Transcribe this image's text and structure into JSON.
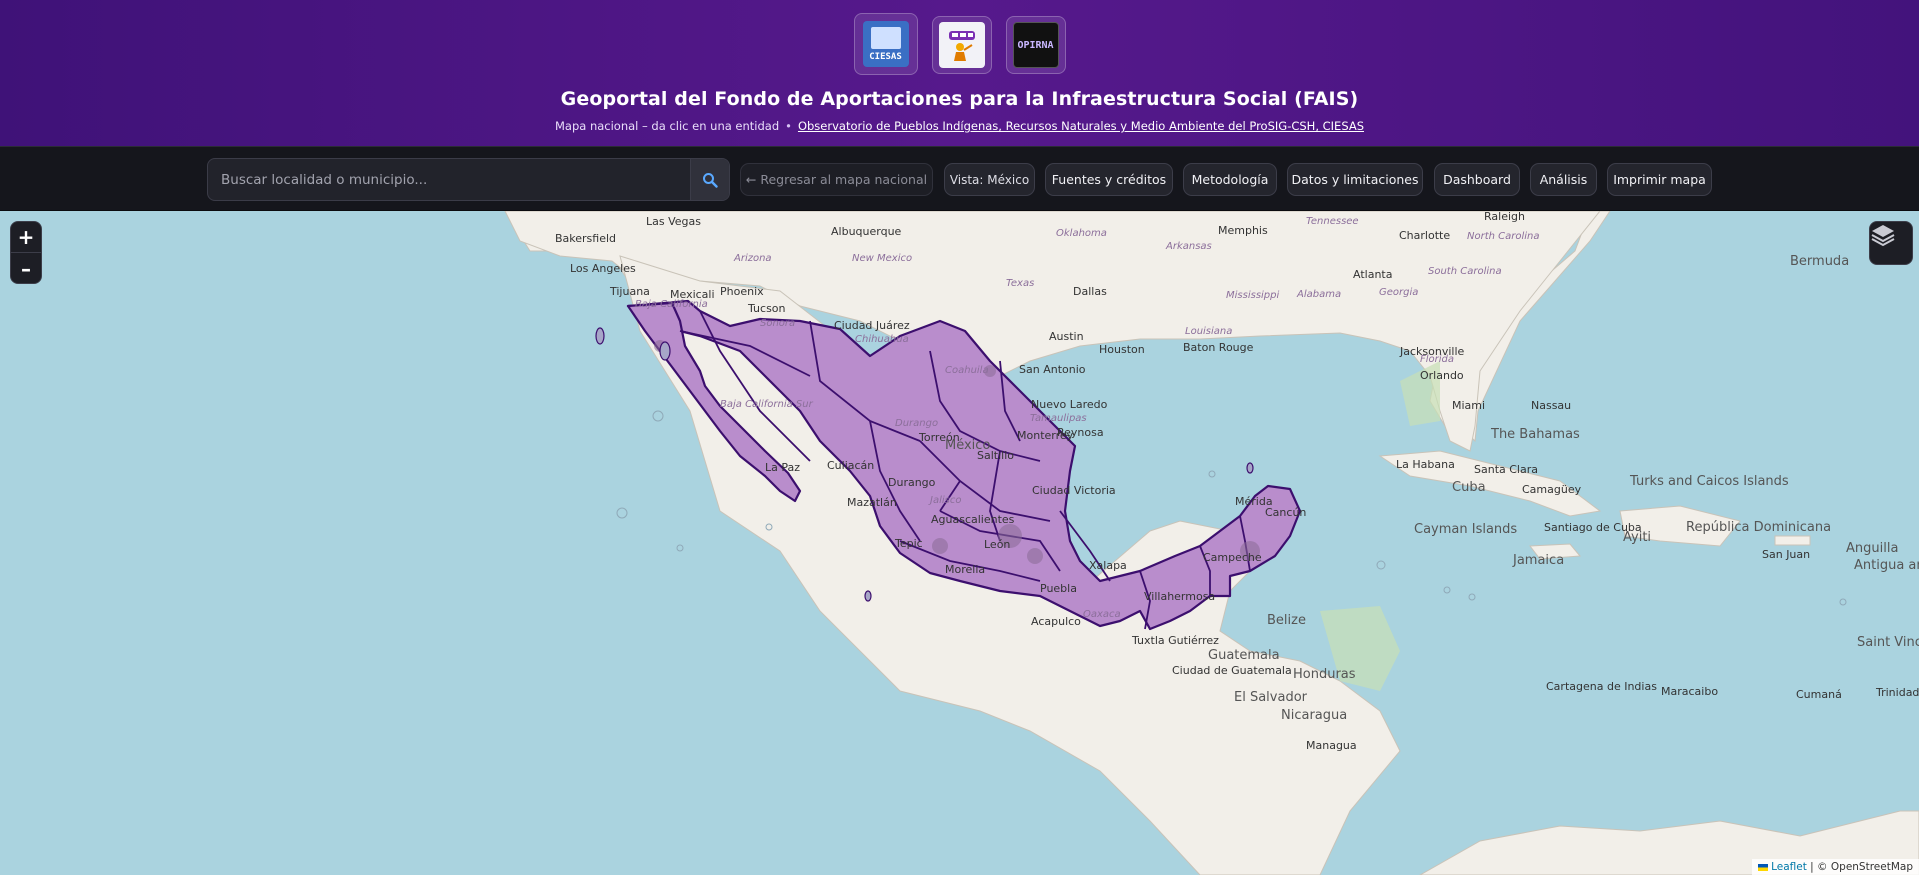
{
  "header": {
    "logos": [
      {
        "name": "ciesas-logo",
        "text": "CIESAS"
      },
      {
        "name": "fais-logo",
        "text": ""
      },
      {
        "name": "opirna-logo",
        "text": "OPIRNA"
      }
    ],
    "title": "Geoportal del Fondo de Aportaciones para la Infraestructura Social (FAIS)",
    "subtitle": "Mapa nacional – da clic en una entidad",
    "separator": "•",
    "link": "Observatorio de Pueblos Indígenas, Recursos Naturales y Medio Ambiente del ProSIG-CSH, CIESAS"
  },
  "toolbar": {
    "search_placeholder": "Buscar localidad o municipio...",
    "search_icon": "search-icon",
    "back_label": "← Regresar al mapa nacional",
    "view_label": "Vista: México",
    "buttons": [
      "Fuentes y créditos",
      "Metodología",
      "Datos y limitaciones",
      "Dashboard",
      "Análisis",
      "Imprimir mapa"
    ]
  },
  "map": {
    "zoom_in": "+",
    "zoom_out": "–",
    "layers_icon": "layers-icon",
    "attribution_leaflet": "Leaflet",
    "attribution_rest": "| © OpenStreetMap",
    "colors": {
      "land": "#f2efe9",
      "water": "#aad3df",
      "mexico_fill": "#b98dcc",
      "mexico_stroke": "#3c0f6e"
    },
    "city_labels": [
      "Las Vegas",
      "Albuquerque",
      "Bakersfield",
      "Los Angeles",
      "Tijuana",
      "Mexicali",
      "Phoenix",
      "Tucson",
      "Ciudad Juárez",
      "Dallas",
      "Austin",
      "San Antonio",
      "Houston",
      "Memphis",
      "Charlotte",
      "Raleigh",
      "Atlanta",
      "Baton Rouge",
      "Jacksonville",
      "Orlando",
      "Nuevo Laredo",
      "Reynosa",
      "Monterrey",
      "Torreón",
      "Saltillo",
      "Culiacán",
      "La Paz",
      "Durango",
      "Mazatlán",
      "Ciudad Victoria",
      "Aguascalientes",
      "León",
      "Tepic",
      "Morelia",
      "Puebla",
      "Xalapa",
      "Acapulco",
      "Villahermosa",
      "Campeche",
      "Mérida",
      "Cancún",
      "Tuxtla Gutiérrez",
      "Guatemala",
      "Ciudad de Guatemala",
      "El Salvador",
      "Honduras",
      "Nicaragua",
      "Managua",
      "Belize",
      "Miami",
      "Nassau",
      "La Habana",
      "Santa Clara",
      "Camagüey",
      "Cuba",
      "Santiago de Cuba",
      "Cayman Islands",
      "Jamaica",
      "Ayiti",
      "República Dominicana",
      "San Juan",
      "Anguilla",
      "Antigua and Barbuda",
      "Turks and Caicos Islands",
      "Saint Vincent and the Grenadines",
      "Trinidad",
      "Cartagena de Indias",
      "Maracaibo",
      "Cumaná",
      "Bermuda",
      "The Bahamas"
    ],
    "region_labels": [
      "Arizona",
      "New Mexico",
      "Oklahoma",
      "Arkansas",
      "Tennessee",
      "North Carolina",
      "South Carolina",
      "Georgia",
      "Alabama",
      "Mississippi",
      "Louisiana",
      "Texas",
      "Florida",
      "Baja California",
      "Sonora",
      "Chihuahua",
      "Coahuila",
      "Baja California Sur",
      "Durango",
      "Tamaulipas",
      "México",
      "Jalisco",
      "Oaxaca"
    ]
  }
}
